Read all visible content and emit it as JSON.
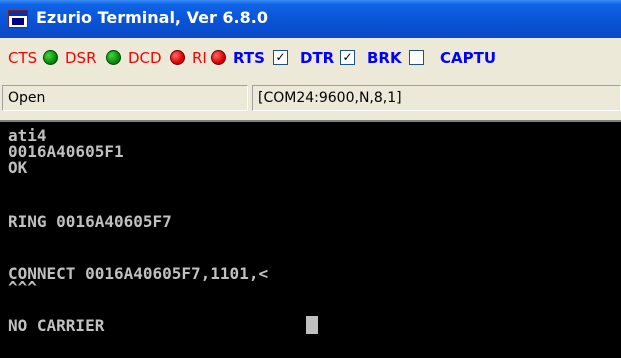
{
  "window": {
    "title": "Ezurio Terminal, Ver 6.8.0"
  },
  "toolbar": {
    "cts_label": "CTS",
    "cts_led": "green",
    "dsr_label": "DSR",
    "dsr_led": "green",
    "dcd_label": "DCD",
    "dcd_led": "red",
    "ri_label": "RI",
    "ri_led": "red",
    "rts_label": "RTS",
    "rts_checked": true,
    "rts_check_glyph": "✓",
    "dtr_label": "DTR",
    "dtr_checked": true,
    "dtr_check_glyph": "✓",
    "brk_label": "BRK",
    "brk_checked": false,
    "capture_label": "CAPTU"
  },
  "status": {
    "port_state": "Open",
    "port_settings": "[COM24:9600,N,8,1]"
  },
  "terminal": {
    "lines": [
      "ati4",
      "0016A40605F1",
      "OK",
      "RING 0016A40605F7",
      "CONNECT 0016A40605F7,1101,<",
      "^^^",
      "NO CARRIER"
    ]
  },
  "colors": {
    "led_green": "#0a8a0a",
    "led_red": "#e00000",
    "label_red": "#ff0000",
    "label_blue": "#0000ff",
    "terminal_bg": "#000000",
    "terminal_text": "#c0c0c0"
  }
}
